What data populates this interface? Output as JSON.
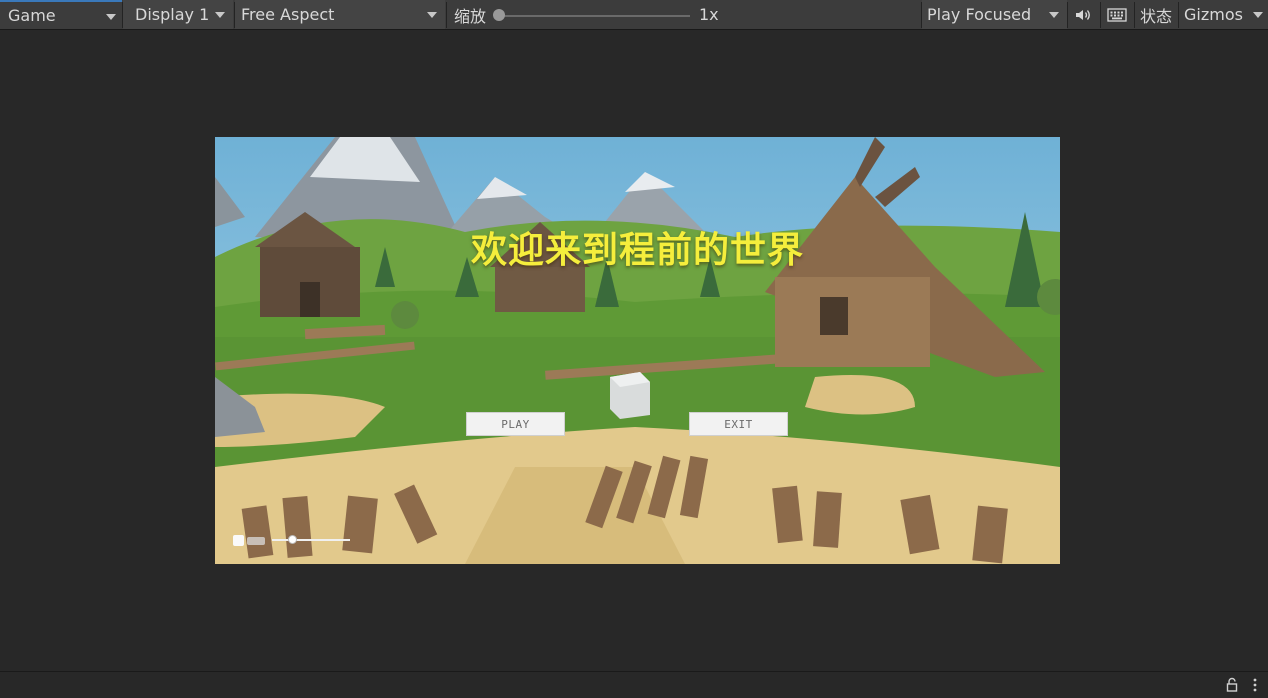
{
  "toolbar": {
    "tab_label": "Game",
    "display": "Display 1",
    "aspect": "Free Aspect",
    "scale_label": "缩放",
    "scale_value": "1x",
    "scale_level": 0.0,
    "play_mode": "Play Focused",
    "audio_icon": "speaker-icon",
    "keyboard_icon": "keyboard-icon",
    "stats": "状态",
    "gizmos": "Gizmos"
  },
  "game": {
    "title": "欢迎来到程前的世界",
    "play_button": "PLAY",
    "exit_button": "EXIT",
    "title_color": "#f5ee3c"
  },
  "status": {
    "lock_icon": "lock-icon",
    "menu_icon": "kebab-menu-icon"
  }
}
